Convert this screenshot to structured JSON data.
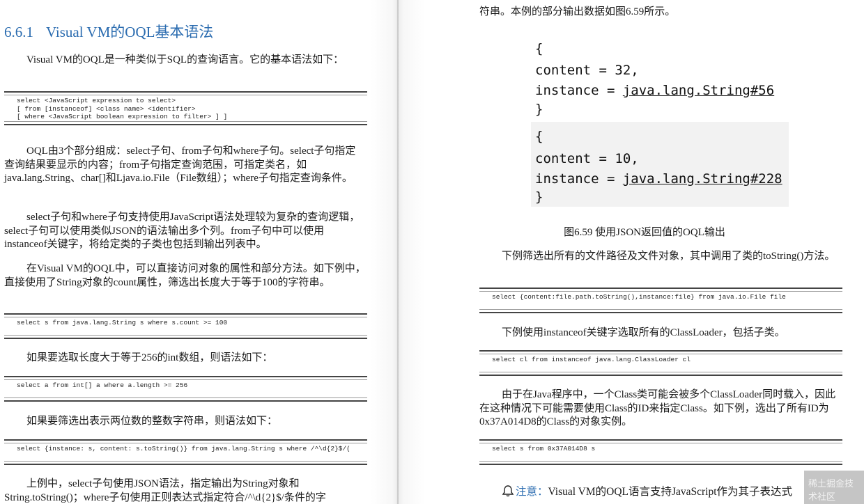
{
  "left": {
    "heading_number": "6.6.1",
    "heading_title": "Visual VM的OQL基本语法",
    "p1": "Visual VM的OQL是一种类似于SQL的查询语言。它的基本语法如下：",
    "code1": "select <JavaScript expression to select>\n[ from [instanceof] <class name> <identifier>\n[ where <JavaScript boolean expression to filter> ] ]",
    "p2": "OQL由3个部分组成：select子句、from子句和where子句。select子句指定查询结果要显示的内容；from子句指定查询范围，可指定类名，如java.lang.String、char[]和Ljava.io.File（File数组）；where子句指定查询条件。",
    "p3": "select子句和where子句支持使用JavaScript语法处理较为复杂的查询逻辑，select子句可以使用类似JSON的语法输出多个列。from子句中可以使用instanceof关键字，将给定类的子类也包括到输出列表中。",
    "p4": "在Visual VM的OQL中，可以直接访问对象的属性和部分方法。如下例中，直接使用了String对象的count属性，筛选出长度大于等于100的字符串。",
    "code2": "select s from java.lang.String s where s.count >= 100",
    "p5": "如果要选取长度大于等于256的int数组，则语法如下：",
    "code3": "select a from int[] a where a.length >= 256",
    "p6": "如果要筛选出表示两位数的整数字符串，则语法如下：",
    "code4": "select {instance: s, content: s.toString()} from java.lang.String s where /^\\d{2}$/(",
    "p7": "上例中，select子句使用JSON语法，指定输出为String对象和String.toString()；where子句使用正则表达式指定符合/^\\d{2}$/条件的字"
  },
  "right": {
    "p0": "符串。本例的部分输出数据如图6.59所示。",
    "figure": {
      "block1": {
        "open": "{",
        "content_line": "content = 32,",
        "instance_prefix": "instance = ",
        "instance_value": "java.lang.String#56",
        "close": "}"
      },
      "block2": {
        "open": "{",
        "content_line": "content = 10,",
        "instance_prefix": "instance = ",
        "instance_value": "java.lang.String#228",
        "close": "}"
      }
    },
    "caption": "图6.59   使用JSON返回值的OQL输出",
    "p1": "下例筛选出所有的文件路径及文件对象，其中调用了类的toString()方法。",
    "code1": "select {content:file.path.toString(),instance:file} from java.io.File file",
    "p2": "下例使用instanceof关键字选取所有的ClassLoader，包括子类。",
    "code2": "select cl from instanceof java.lang.ClassLoader cl",
    "p3": "由于在Java程序中，一个Class类可能会被多个ClassLoader同时载入，因此在这种情况下可能需要使用Class的ID来指定Class。如下例，选出了所有ID为0x37A014D8的Class的对象实例。",
    "code3": "select s from 0x37A014D8 s",
    "note_label": "注意：",
    "note_text": "Visual VM的OQL语言支持JavaScript作为其子表达式"
  },
  "watermark": "稀土掘金技术社区"
}
